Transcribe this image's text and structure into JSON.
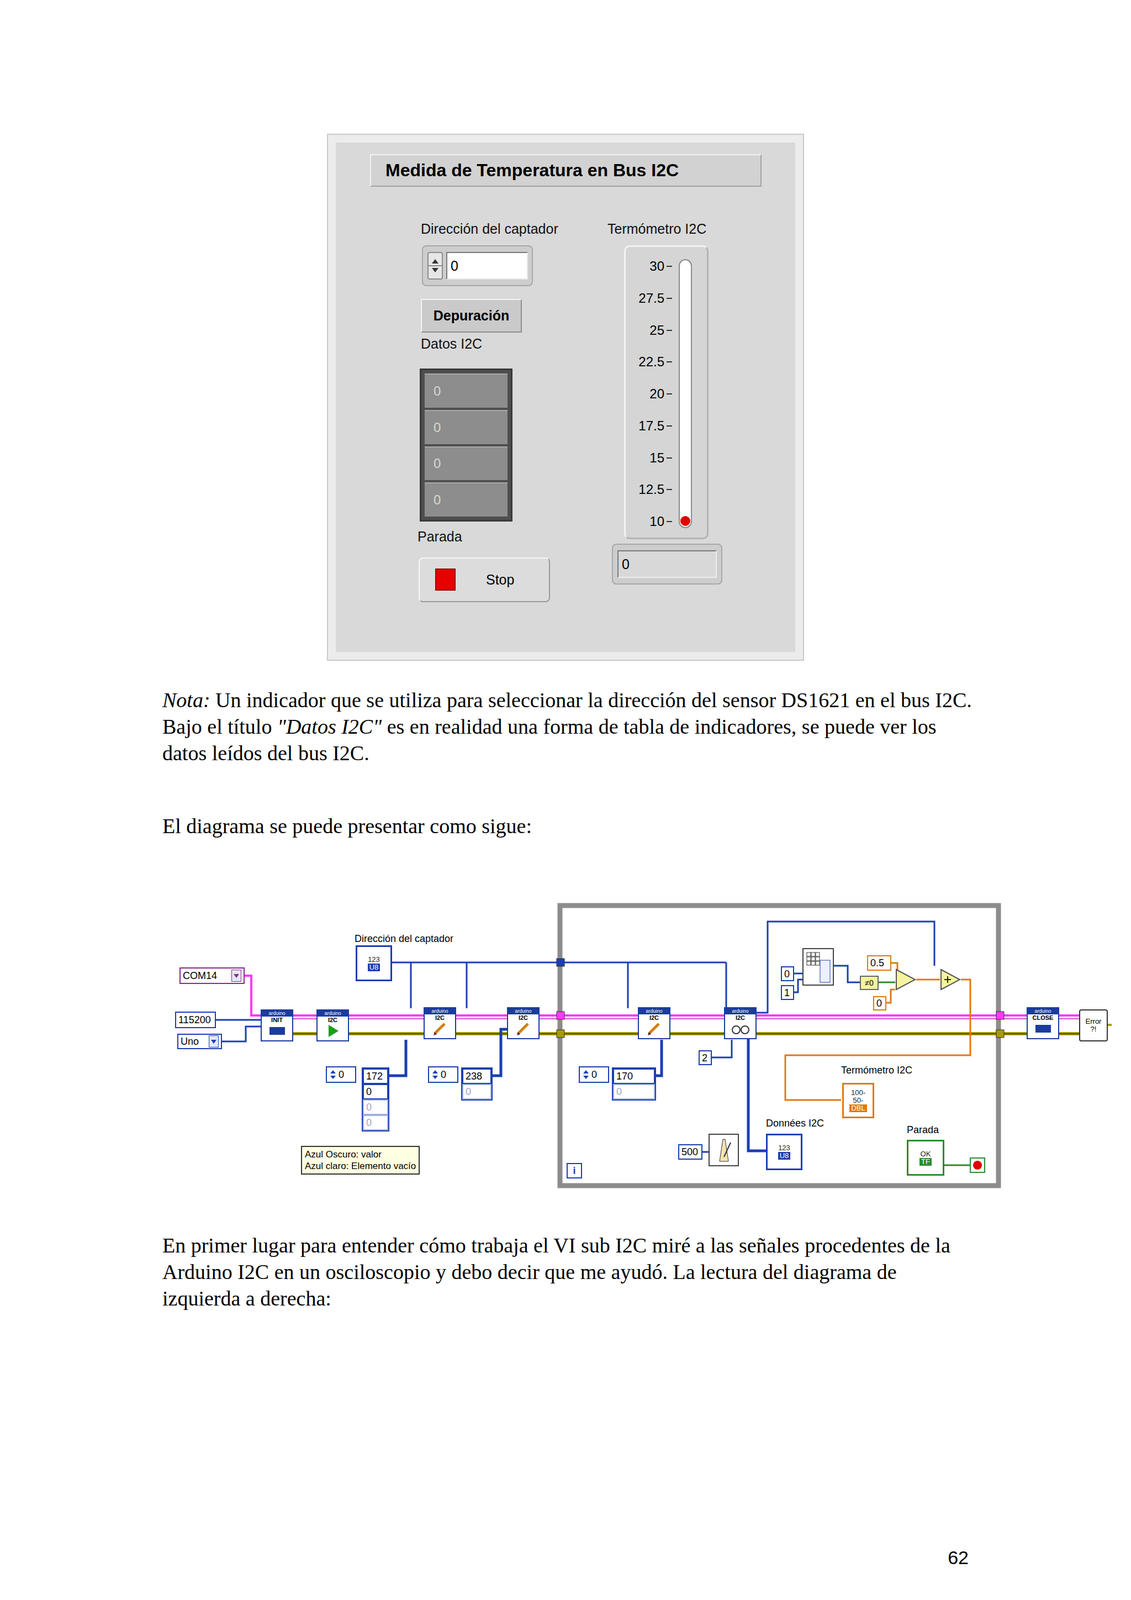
{
  "front_panel": {
    "title": "Medida de Temperatura en Bus I2C",
    "address": {
      "label": "Dirección del captador",
      "value": "0"
    },
    "debug_button": {
      "label": "Depuración"
    },
    "data_array": {
      "label": "Datos I2C",
      "values": [
        "0",
        "0",
        "0",
        "0"
      ]
    },
    "stop": {
      "label": "Parada",
      "button": "Stop"
    },
    "thermometer": {
      "label": "Termómetro I2C",
      "ticks": [
        "30",
        "27.5",
        "25",
        "22.5",
        "20",
        "17.5",
        "15",
        "12.5",
        "10"
      ],
      "level": 0,
      "reading": "0"
    }
  },
  "paragraphs": [
    {
      "segments": [
        {
          "text": "Nota:",
          "kind": "italic"
        },
        {
          "text": " Un indicador que se utiliza para seleccionar la dirección del sensor DS1621 en el bus I2C. Bajo el título ",
          "kind": "plain"
        },
        {
          "text": "\"Datos I2C\"",
          "kind": "italic"
        },
        {
          "text": " es en realidad una forma de tabla de indicadores, se puede ver los datos leídos del bus I2C.",
          "kind": "plain"
        }
      ]
    },
    {
      "segments": [
        {
          "text": "El diagrama se puede presentar como sigue:",
          "kind": "plain"
        }
      ]
    },
    {
      "segments": [
        {
          "text": "En primer lugar para entender cómo trabaja el VI sub I2C miré a las señales procedentes de la Arduino I2C en un osciloscopio y debo decir que me ayudó. La lectura del diagrama de izquierda a derecha:",
          "kind": "plain"
        }
      ]
    }
  ],
  "diagram": {
    "labels": [
      "Dirección del captador",
      "Termómetro I2C",
      "Données I2C",
      "Parada"
    ],
    "constants": [
      {
        "text": "COM14",
        "color": "#8a2a8a"
      },
      {
        "text": "115200",
        "color": "#1a3fb0"
      },
      {
        "text": "Uno",
        "color": "#1a3fb0"
      },
      {
        "text": "2",
        "color": "#1a3fb0"
      },
      {
        "text": "0",
        "color": "#1a3fb0"
      },
      {
        "text": "1",
        "color": "#1a3fb0"
      },
      {
        "text": "0.5",
        "color": "#e07a10"
      },
      {
        "text": "0",
        "color": "#e07a10"
      },
      {
        "text": "500",
        "color": "#1a3fb0"
      }
    ],
    "subvis": [
      {
        "top": "arduino",
        "text": "INIT",
        "kind": "init"
      },
      {
        "top": "arduino",
        "text": "I2C",
        "kind": "run"
      },
      {
        "top": "arduino",
        "text": "I2C",
        "kind": "write"
      },
      {
        "top": "arduino",
        "text": "I2C",
        "kind": "write"
      },
      {
        "top": "arduino",
        "text": "I2C",
        "kind": "write"
      },
      {
        "top": "arduino",
        "text": "I2C",
        "kind": "read"
      },
      {
        "top": "arduino",
        "text": "CLOSE",
        "kind": "close"
      }
    ],
    "arrays": [
      {
        "index": "0",
        "values": [
          {
            "text": "172",
            "empty": false
          },
          {
            "text": "0",
            "empty": false
          },
          {
            "text": "0",
            "empty": true
          },
          {
            "text": "0",
            "empty": true
          }
        ]
      },
      {
        "index": "0",
        "values": [
          {
            "text": "238",
            "empty": false
          },
          {
            "text": "0",
            "empty": true
          }
        ]
      },
      {
        "index": "0",
        "values": [
          {
            "text": "170",
            "empty": false
          },
          {
            "text": "0",
            "empty": true
          }
        ]
      }
    ],
    "tooltip": [
      "Azul Oscuro: valor",
      "Azul claro: Elemento vacío"
    ],
    "terminals": [
      {
        "lines": [
          "123",
          "U8"
        ]
      },
      {
        "lines": [
          "100-",
          "50-",
          "DBL"
        ]
      },
      {
        "lines": [
          "123",
          "U8"
        ]
      },
      {
        "lines": [
          "OK",
          "TF"
        ]
      }
    ],
    "compare": "≠0",
    "loop_index": "i",
    "error_handler": [
      "Error",
      "?!"
    ]
  },
  "page_number": "62"
}
